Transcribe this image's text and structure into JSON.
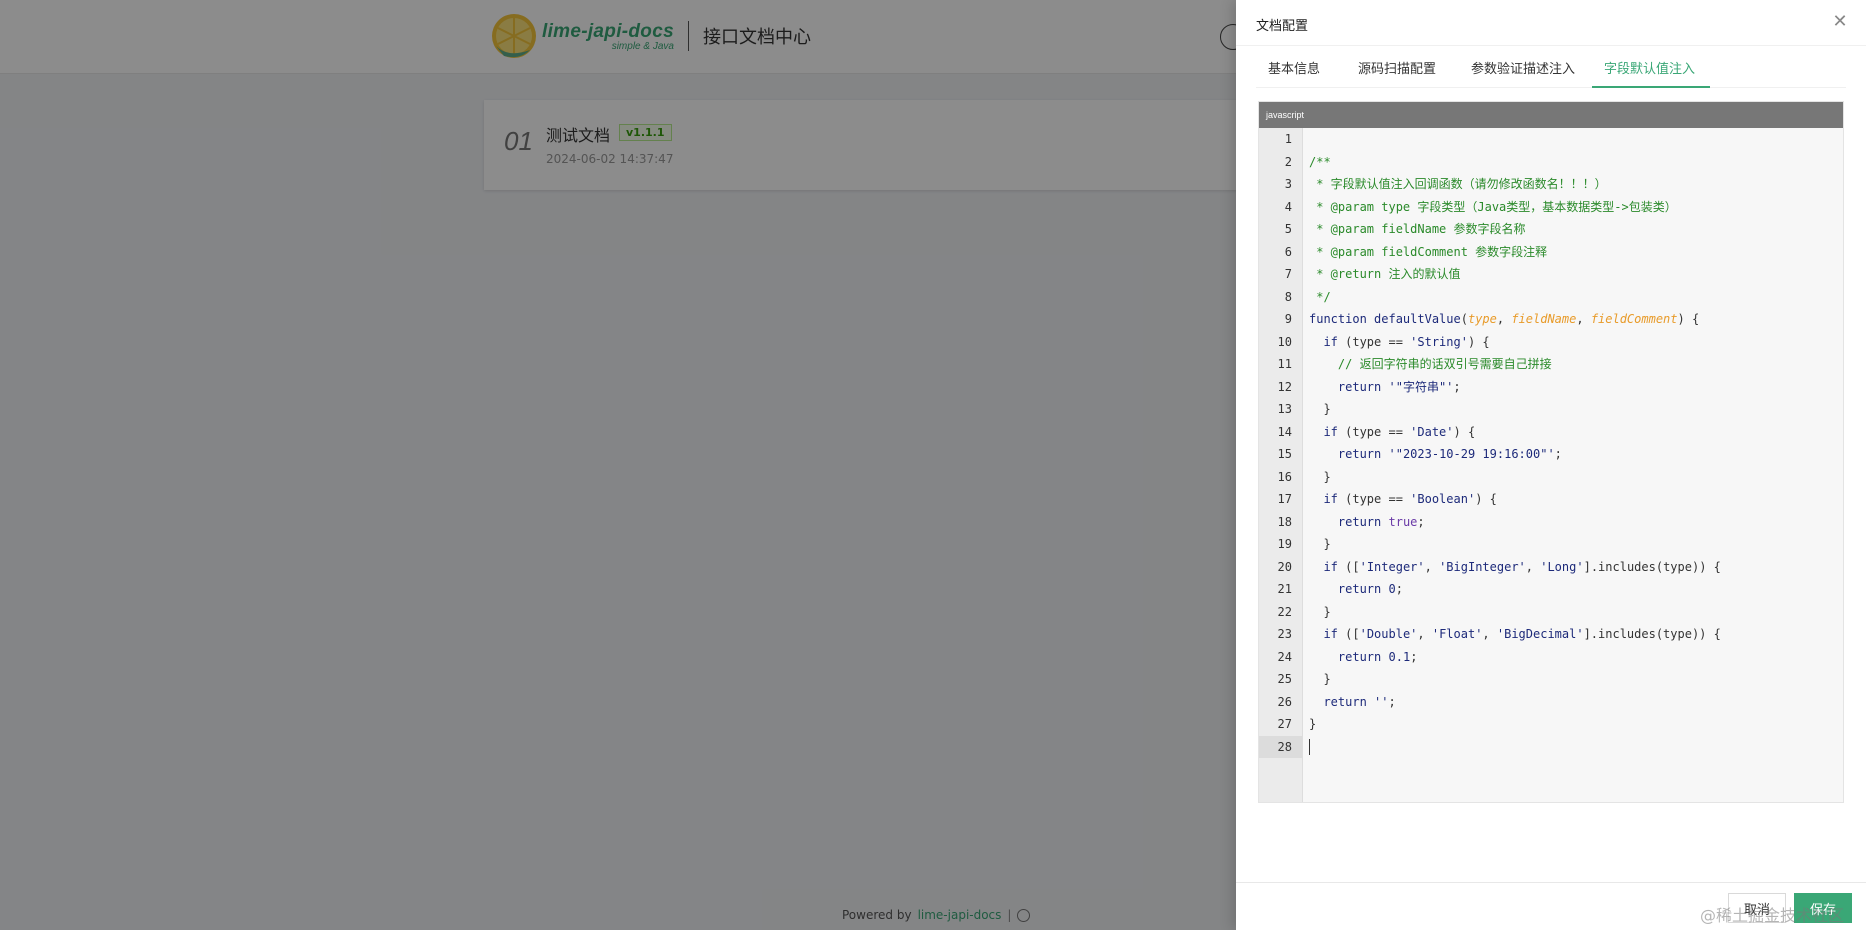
{
  "header": {
    "logo_main": "lime-japi-docs",
    "logo_sub": "simple & Java",
    "site_title": "接口文档中心"
  },
  "doc_card": {
    "number": "01",
    "name": "测试文档",
    "version": "v1.1.1",
    "time": "2024-06-02 14:37:47"
  },
  "footer": {
    "powered": "Powered by",
    "link": "lime-japi-docs",
    "separator": "|"
  },
  "drawer": {
    "title": "文档配置",
    "tabs": [
      "基本信息",
      "源码扫描配置",
      "参数验证描述注入",
      "字段默认值注入"
    ],
    "active_tab": 3,
    "editor_language": "javascript",
    "cancel_label": "取消",
    "save_label": "保存"
  },
  "watermark": "@稀土掘金技术社区",
  "colors": {
    "accent": "#3aa776",
    "mask": "rgba(0,0,0,0.45)"
  },
  "icons": {
    "close": "close-icon",
    "user": "user-icon",
    "logo": "lemon-logo-icon"
  }
}
